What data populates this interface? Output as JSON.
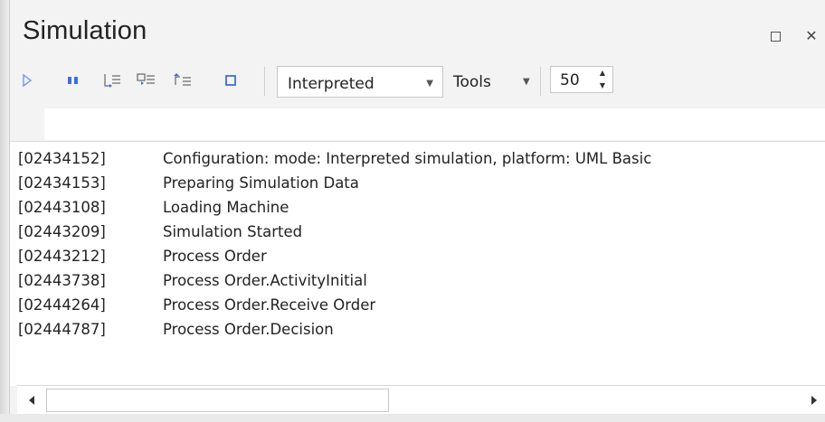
{
  "window": {
    "title": "Simulation",
    "restore_icon": "restore-icon",
    "close_icon": "close-icon",
    "close_glyph": "✕"
  },
  "toolbar": {
    "icons": [
      "run-icon",
      "pause-icon",
      "step-into-icon",
      "step-over-icon",
      "step-out-icon",
      "stop-icon"
    ],
    "mode_value": "Interpreted",
    "tools_label": "Tools",
    "speed_value": "50",
    "accent_color": "#3f6fd8"
  },
  "output": {
    "lines": [
      {
        "ts": "[02434152]",
        "msg": "Configuration: mode: Interpreted simulation, platform: UML Basic"
      },
      {
        "ts": "[02434153]",
        "msg": "Preparing Simulation Data"
      },
      {
        "ts": "[02443108]",
        "msg": "Loading Machine"
      },
      {
        "ts": "[02443209]",
        "msg": "Simulation Started"
      },
      {
        "ts": "[02443212]",
        "msg": "Process Order"
      },
      {
        "ts": "[02443738]",
        "msg": "Process Order.ActivityInitial"
      },
      {
        "ts": "[02444264]",
        "msg": "Process Order.Receive Order"
      },
      {
        "ts": "[02444787]",
        "msg": "Process Order.Decision"
      }
    ]
  },
  "scrollbar": {
    "left_icon": "scroll-left-icon",
    "right_icon": "scroll-right-icon"
  }
}
